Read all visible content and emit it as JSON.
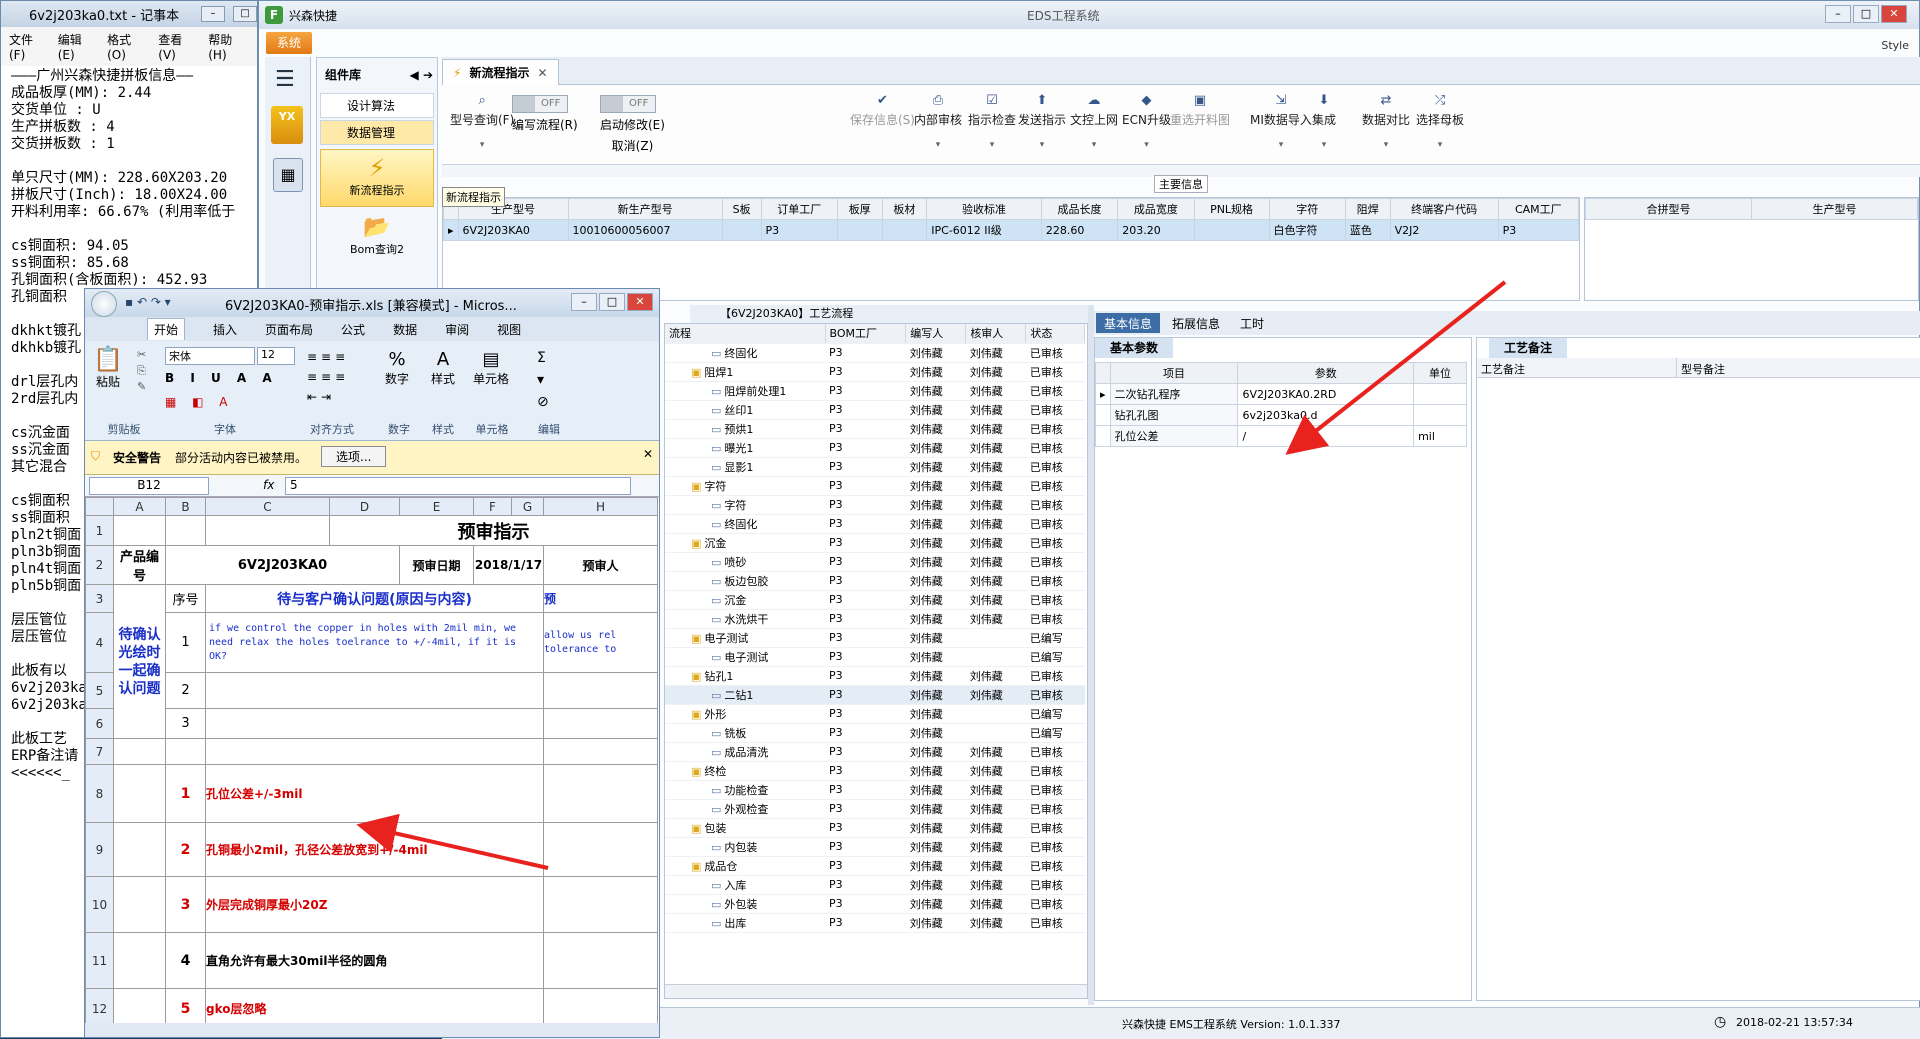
{
  "notepad": {
    "title": "6v2j203ka0.txt - 记事本",
    "menu": [
      "文件(F)",
      "编辑(E)",
      "格式(O)",
      "查看(V)",
      "帮助(H)"
    ],
    "lines": [
      "———广州兴森快捷拼板信息——",
      "成品板厚(MM): 2.44",
      "交货单位 : U",
      "生产拼板数 : 4",
      "交货拼板数 : 1",
      "",
      "单只尺寸(MM): 228.60X203.20",
      "拼板尺寸(Inch): 18.00X24.00",
      "开料利用率: 66.67% (利用率低于",
      "",
      "cs铜面积: 94.05",
      "ss铜面积: 85.68",
      "孔铜面积(含板面积): 452.93",
      "孔铜面积",
      "",
      "dkhkt镀孔",
      "dkhkb镀孔",
      "",
      "drl层孔内",
      "2rd层孔内",
      "",
      "cs沉金面",
      "ss沉金面",
      "其它混合",
      "",
      "cs铜面积",
      "ss铜面积",
      "pln2t铜面",
      "pln3b铜面",
      "pln4t铜面",
      "pln5b铜面",
      "",
      "层压管位",
      "层压管位",
      "",
      "此板有以",
      "6v2j203ka",
      "6v2j203ka",
      "",
      "此板工艺",
      "ERP备注请",
      "<<<<<<_"
    ]
  },
  "app": {
    "title": "兴森快捷",
    "center_title": "EDS工程系统",
    "logo_text": "EDS",
    "style_label": "Style",
    "system_btn": "系统",
    "component_lib": "组件库",
    "comp_items": [
      "设计算法",
      "数据管理"
    ],
    "new_flow": "新流程指示",
    "bom_query": "Bom查询2",
    "tab": "新流程指示",
    "tooltip": "新流程指示",
    "main_info": "主要信息",
    "toggles": [
      {
        "state": "OFF",
        "label": "编写流程(R)"
      },
      {
        "state": "OFF",
        "label": "启动修改(E)"
      }
    ],
    "cancel_label": "取消(Z)",
    "ribbon": [
      {
        "label": "型号查询(F)",
        "icon": "search-icon"
      },
      {
        "label": "保存信息(S)",
        "icon": "check-icon",
        "disabled": true
      },
      {
        "label": "内部审核",
        "icon": "printer-icon"
      },
      {
        "label": "指示检查",
        "icon": "clipboard-check-icon"
      },
      {
        "label": "发送指示",
        "icon": "upload-icon"
      },
      {
        "label": "文控上网",
        "icon": "cloud-upload-icon"
      },
      {
        "label": "ECN升级",
        "icon": "ecn-icon"
      },
      {
        "label": "重选开料图",
        "icon": "image-icon",
        "disabled": true
      },
      {
        "label": "MI数据导入",
        "icon": "import-icon"
      },
      {
        "label": "集成",
        "icon": "download-icon"
      },
      {
        "label": "数据对比",
        "icon": "compare-icon"
      },
      {
        "label": "选择母板",
        "icon": "shuffle-icon"
      }
    ],
    "main_grid": {
      "headers": [
        "生产型号",
        "新生产型号",
        "S板",
        "订单工厂",
        "板厚",
        "板材",
        "验收标准",
        "成品长度",
        "成品宽度",
        "PNL规格",
        "字符",
        "阻焊",
        "终端客户代码",
        "CAM工厂"
      ],
      "row": [
        "6V2J203KA0",
        "10010600056007",
        "",
        "P3",
        "",
        "",
        "IPC-6012 II级",
        "228.60",
        "203.20",
        "",
        "白色字符",
        "蓝色",
        "V2J2",
        "P3"
      ]
    },
    "side_grid": {
      "headers": [
        "合拼型号",
        "生产型号"
      ]
    },
    "flow_title": "【6V2J203KA0】工艺流程",
    "flow_headers": [
      "流程",
      "BOM工厂",
      "编写人",
      "核审人",
      "状态"
    ],
    "flow_rows": [
      [
        "2",
        "终固化",
        "P3",
        "刘伟藏",
        "刘伟藏",
        "已审核"
      ],
      [
        "1",
        "阻焊1",
        "P3",
        "刘伟藏",
        "刘伟藏",
        "已审核"
      ],
      [
        "2",
        "阻焊前处理1",
        "P3",
        "刘伟藏",
        "刘伟藏",
        "已审核"
      ],
      [
        "2",
        "丝印1",
        "P3",
        "刘伟藏",
        "刘伟藏",
        "已审核"
      ],
      [
        "2",
        "预烘1",
        "P3",
        "刘伟藏",
        "刘伟藏",
        "已审核"
      ],
      [
        "2",
        "曝光1",
        "P3",
        "刘伟藏",
        "刘伟藏",
        "已审核"
      ],
      [
        "2",
        "显影1",
        "P3",
        "刘伟藏",
        "刘伟藏",
        "已审核"
      ],
      [
        "1",
        "字符",
        "P3",
        "刘伟藏",
        "刘伟藏",
        "已审核"
      ],
      [
        "2",
        "字符",
        "P3",
        "刘伟藏",
        "刘伟藏",
        "已审核"
      ],
      [
        "2",
        "终固化",
        "P3",
        "刘伟藏",
        "刘伟藏",
        "已审核"
      ],
      [
        "1",
        "沉金",
        "P3",
        "刘伟藏",
        "刘伟藏",
        "已审核"
      ],
      [
        "2",
        "喷砂",
        "P3",
        "刘伟藏",
        "刘伟藏",
        "已审核"
      ],
      [
        "2",
        "板边包胶",
        "P3",
        "刘伟藏",
        "刘伟藏",
        "已审核"
      ],
      [
        "2",
        "沉金",
        "P3",
        "刘伟藏",
        "刘伟藏",
        "已审核"
      ],
      [
        "2",
        "水洗烘干",
        "P3",
        "刘伟藏",
        "刘伟藏",
        "已审核"
      ],
      [
        "1",
        "电子测试",
        "P3",
        "刘伟藏",
        "",
        "已编写"
      ],
      [
        "2",
        "电子测试",
        "P3",
        "刘伟藏",
        "",
        "已编写"
      ],
      [
        "1",
        "钻孔1",
        "P3",
        "刘伟藏",
        "刘伟藏",
        "已审核"
      ],
      [
        "2",
        "二钻1",
        "P3",
        "刘伟藏",
        "刘伟藏",
        "已审核"
      ],
      [
        "1",
        "外形",
        "P3",
        "刘伟藏",
        "",
        "已编写"
      ],
      [
        "2",
        "铣板",
        "P3",
        "刘伟藏",
        "",
        "已编写"
      ],
      [
        "2",
        "成品清洗",
        "P3",
        "刘伟藏",
        "刘伟藏",
        "已审核"
      ],
      [
        "1",
        "终检",
        "P3",
        "刘伟藏",
        "刘伟藏",
        "已审核"
      ],
      [
        "2",
        "功能检查",
        "P3",
        "刘伟藏",
        "刘伟藏",
        "已审核"
      ],
      [
        "2",
        "外观检查",
        "P3",
        "刘伟藏",
        "刘伟藏",
        "已审核"
      ],
      [
        "1",
        "包装",
        "P3",
        "刘伟藏",
        "刘伟藏",
        "已审核"
      ],
      [
        "2",
        "内包装",
        "P3",
        "刘伟藏",
        "刘伟藏",
        "已审核"
      ],
      [
        "1",
        "成品仓",
        "P3",
        "刘伟藏",
        "刘伟藏",
        "已审核"
      ],
      [
        "2",
        "入库",
        "P3",
        "刘伟藏",
        "刘伟藏",
        "已审核"
      ],
      [
        "2",
        "外包装",
        "P3",
        "刘伟藏",
        "刘伟藏",
        "已审核"
      ],
      [
        "2",
        "出库",
        "P3",
        "刘伟藏",
        "刘伟藏",
        "已审核"
      ]
    ],
    "info_tabs": [
      "基本信息",
      "拓展信息",
      "工时"
    ],
    "basic_params": "基本参数",
    "param_headers": [
      "项目",
      "参数",
      "单位"
    ],
    "params": [
      [
        "二次钻孔程序",
        "6V2J203KA0.2RD",
        ""
      ],
      [
        "钻孔孔图",
        "6v2j203ka0.d",
        ""
      ],
      [
        "孔位公差",
        "/",
        "mil"
      ]
    ],
    "craft_tab": "工艺备注",
    "craft_headers": [
      "工艺备注",
      "型号备注"
    ],
    "status": "兴森快捷 EMS工程系统 Version: 1.0.1.337",
    "clock": "2018-02-21 13:57:34"
  },
  "excel": {
    "title": "6V2J203KA0-预审指示.xls [兼容模式] - Micros...",
    "tabs": [
      "开始",
      "插入",
      "页面布局",
      "公式",
      "数据",
      "审阅",
      "视图"
    ],
    "font": "宋体",
    "size": "12",
    "groups": [
      "剪贴板",
      "字体",
      "对齐方式",
      "数字",
      "样式",
      "单元格",
      "编辑"
    ],
    "big": [
      "粘贴",
      "数字",
      "样式",
      "单元格"
    ],
    "warning": "安全警告",
    "warning_text": "部分活动内容已被禁用。",
    "options_btn": "选项...",
    "namebox": "B12",
    "formula": "5",
    "cols": [
      "A",
      "B",
      "C",
      "D",
      "E",
      "F",
      "G",
      "H"
    ],
    "sheet_title": "预审指示",
    "product_no": "产品编号",
    "model": "6V2J203KA0",
    "review_date_label": "预审日期",
    "review_date": "2018/1/17",
    "reviewer": "预审人",
    "seq": "序号",
    "confirm_header": "待与客户确认问题(原因与内容)",
    "confirm_header_right": "预",
    "side_label": "待确认光绘时一起确认问题",
    "q1": "if we control the copper in holes with 2mil min, we need relax the holes toelrance to +/-4mil, if it is OK?",
    "q1_right": "allow us rel tolerance to",
    "n1": "1",
    "n2": "2",
    "n3": "3",
    "n4": "4",
    "n5": "5",
    "items": [
      "孔位公差+/-3mil",
      "孔铜最小2mil，孔径公差放宽到+/-4mil",
      "外层完成铜厚最小20Z",
      "直角允许有最大30mil半径的圆角",
      "gko层忽略"
    ]
  }
}
